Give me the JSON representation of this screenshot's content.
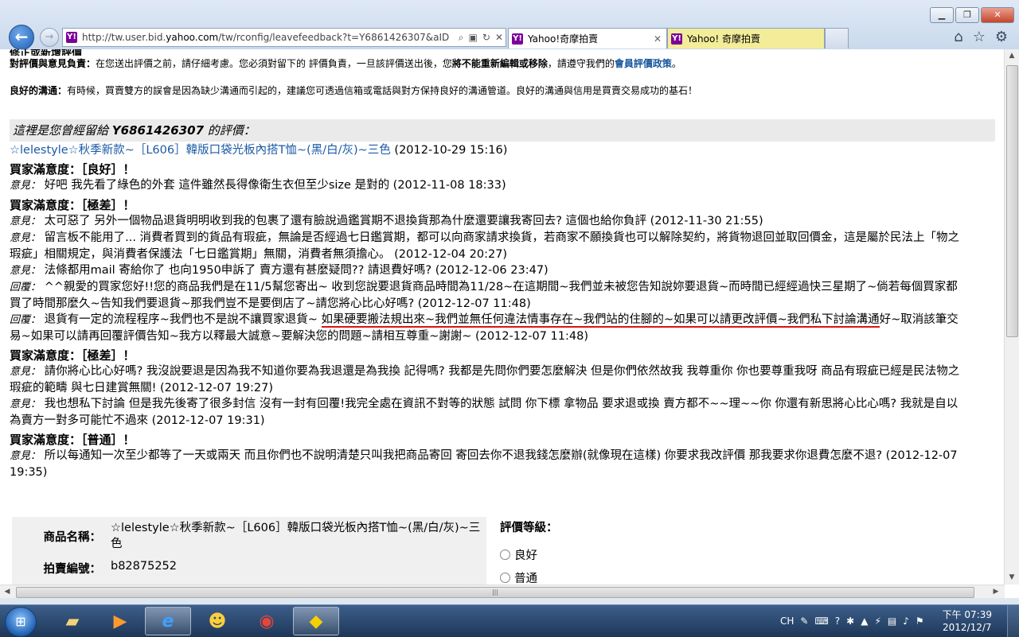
{
  "browser": {
    "url_prefix": "http://tw.user.bid.",
    "url_domain": "yahoo.com",
    "url_rest": "/tw/rconfig/leavefeedback?t=Y6861426307&aID",
    "tabs": [
      {
        "label": "Yahoo!奇摩拍賣"
      },
      {
        "label": "Yahoo! 奇摩拍賣"
      }
    ]
  },
  "page": {
    "top_title": "修正或新增評價",
    "notice1_label": "對評價與意見負責：",
    "notice1_a": "在您送出評價之前，請仔細考慮。您必須對留下的 評價負責，一旦該評價送出後，您",
    "notice1_strong": "將不能重新編輯或移除",
    "notice1_b": "，請遵守我們的",
    "notice1_link": "會員評價政策",
    "notice1_end": "。",
    "notice2_label": "良好的溝通：",
    "notice2_text": "有時候，買賣雙方的誤會是因為缺少溝通而引起的，建議您可透過信箱或電話與對方保持良好的溝通管道。良好的溝通與信用是買賣交易成功的基石！",
    "header_prefix": "這裡是您曾經留給 ",
    "header_user": "Y6861426307",
    "header_suffix": " 的評價："
  },
  "item": {
    "name": "☆lelestyle☆秋季新款~［L606］韓版口袋光板內搭T恤~(黑/白/灰)~三色",
    "time": " (2012-10-29 15:16)"
  },
  "labels": {
    "opinion": "意見：",
    "reply": "回覆："
  },
  "feedback": {
    "sat1": "買家滿意度：［良好］！",
    "e1": "好吧 我先看了綠色的外套 這件雖然長得像衛生衣但至少size 是對的 (2012-11-08 18:33)",
    "sat2": "買家滿意度：［極差］！",
    "e2": "太可惡了 另外一個物品退貨明明收到我的包裹了還有臉說過鑑賞期不退換貨那為什麼還要讓我寄回去? 這個也給你負評 (2012-11-30 21:55)",
    "e3": "留言板不能用了... 消費者買到的貨品有瑕疵，無論是否經過七日鑑賞期，都可以向商家請求換貨，若商家不願換貨也可以解除契約，將貨物退回並取回價金，這是屬於民法上「物之瑕疵」相關規定，與消費者保護法「七日鑑賞期」無關，消費者無須擔心。 (2012-12-04 20:27)",
    "e4": "法條都用mail 寄給你了 也向1950申訴了 賣方還有甚麼疑問?? 請退費好嗎? (2012-12-06 23:47)",
    "r1": "^^親愛的買家您好!!您的商品我們是在11/5幫您寄出~ 收到您說要退貨商品時間為11/28~在這期間~我們並未被您告知說妳要退貨~而時間已經經過快三星期了~倘若每個買家都買了時間那麼久~告知我們要退貨~那我們豈不是要倒店了~請您將心比心好嗎? (2012-12-07 11:48)",
    "r2_a": "退貨有一定的流程程序~我們也不是說不讓買家退貨~ ",
    "r2_u": "如果硬要搬法規出來~我們並無任何違法情事存在~我們站的住腳的~如果可以請更改評價~我們私下討論溝通",
    "r2_b": "好~取消該筆交易~如果可以請再回覆評價告知~我方以釋最大誠意~要解決您的問題~請相互尊重~謝謝~ (2012-12-07 11:48)",
    "sat3": "買家滿意度：［極差］！",
    "e5": "請你將心比心好嗎? 我沒說要退是因為我不知道你要為我退還是為我換 記得嗎? 我都是先問你們要怎麼解決 但是你們依然故我 我尊重你 你也要尊重我呀 商品有瑕疵已經是民法物之瑕疵的範疇 與七日建賞無關! (2012-12-07 19:27)",
    "e6": "我也想私下討論 但是我先後寄了很多封信 沒有一封有回覆!我完全處在資訊不對等的狀態 試問 你下標 拿物品 要求退或換 賣方都不~~理~~你 你還有新思將心比心嗎? 我就是自以為賣方一對多可能忙不過來 (2012-12-07 19:31)",
    "sat4": "買家滿意度：［普通］！",
    "e7": "所以每通知一次至少都等了一天或兩天 而且你們也不說明清楚只叫我把商品寄回 寄回去你不退我錢怎麼辦(就像現在這樣) 你要求我改評價 那我要求你退費怎麼不退? (2012-12-07 19:35)"
  },
  "form": {
    "product_label": "商品名稱：",
    "product_value": "☆lelestyle☆秋季新款~［L606］韓版口袋光板內搭T恤~(黑/白/灰)~三色",
    "auction_label": "拍賣編號：",
    "auction_value": "b82875252",
    "rating_title": "評價等級：",
    "rating_good": "良好",
    "rating_normal": "普通"
  },
  "taskbar": {
    "lang": "CH",
    "time": "下午 07:39",
    "date": "2012/12/7"
  }
}
